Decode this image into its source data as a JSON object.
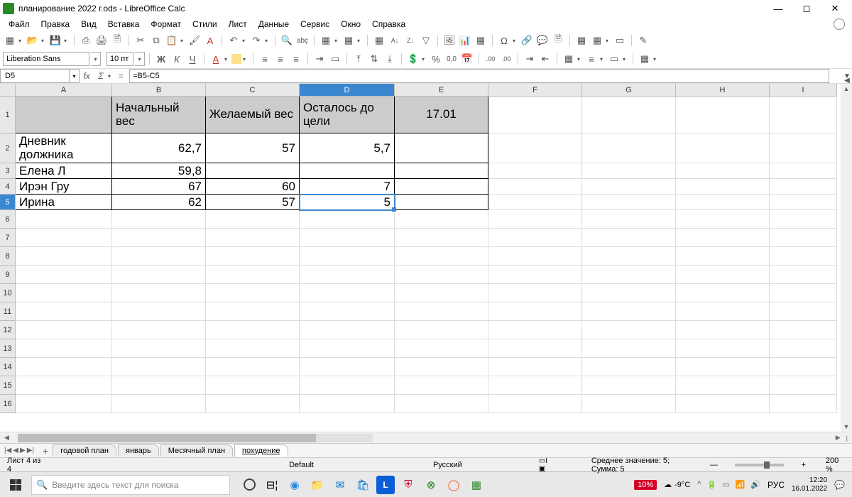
{
  "titlebar": {
    "title": "планирование 2022 г.ods - LibreOffice Calc"
  },
  "menu": [
    "Файл",
    "Правка",
    "Вид",
    "Вставка",
    "Формат",
    "Стили",
    "Лист",
    "Данные",
    "Сервис",
    "Окно",
    "Справка"
  ],
  "toolbar2": {
    "font": "Liberation Sans",
    "size": "10 пт",
    "bold": "Ж",
    "italic": "К",
    "underline": "Ч",
    "percent": "%",
    "num": "0,0",
    "az": ".00",
    "za": ".00"
  },
  "formulabar": {
    "cellref": "D5",
    "formula": "=B5-C5",
    "fx": "fx",
    "sigma": "Σ",
    "eq": "="
  },
  "columns": [
    "A",
    "B",
    "C",
    "D",
    "E",
    "F",
    "G",
    "H",
    "I"
  ],
  "row1": {
    "B": "Начальный вес",
    "C": "Желаемый вес",
    "D": "Осталось до цели",
    "E": "17.01"
  },
  "rows": [
    {
      "A": "Дневник должника",
      "B": "62,7",
      "C": "57",
      "D": "5,7"
    },
    {
      "A": "Елена Л",
      "B": "59,8",
      "C": "",
      "D": ""
    },
    {
      "A": "Ирэн Гру",
      "B": "67",
      "C": "60",
      "D": "7"
    },
    {
      "A": "Ирина",
      "B": "62",
      "C": "57",
      "D": "5"
    }
  ],
  "rownums": [
    "1",
    "2",
    "3",
    "4",
    "5",
    "6",
    "7",
    "8",
    "9",
    "10",
    "11",
    "12",
    "13",
    "14",
    "15",
    "16"
  ],
  "tabs": {
    "nav": [
      "|◀",
      "◀",
      "▶",
      "▶|"
    ],
    "plus": "+",
    "items": [
      "годовой план",
      "январь",
      "Месячный план",
      "похудение"
    ],
    "active": 3
  },
  "status": {
    "sheetcount": "Лист 4 из 4",
    "style": "Default",
    "lang": "Русский",
    "avg_sum": "Среднее значение: 5; Сумма: 5",
    "zoom": "200 %"
  },
  "taskbar": {
    "search_placeholder": "Введите здесь текст для поиска",
    "battery": "10%",
    "temp": "-9°C",
    "lang": "РУС",
    "time": "12:20",
    "date": "16.01.2022"
  }
}
